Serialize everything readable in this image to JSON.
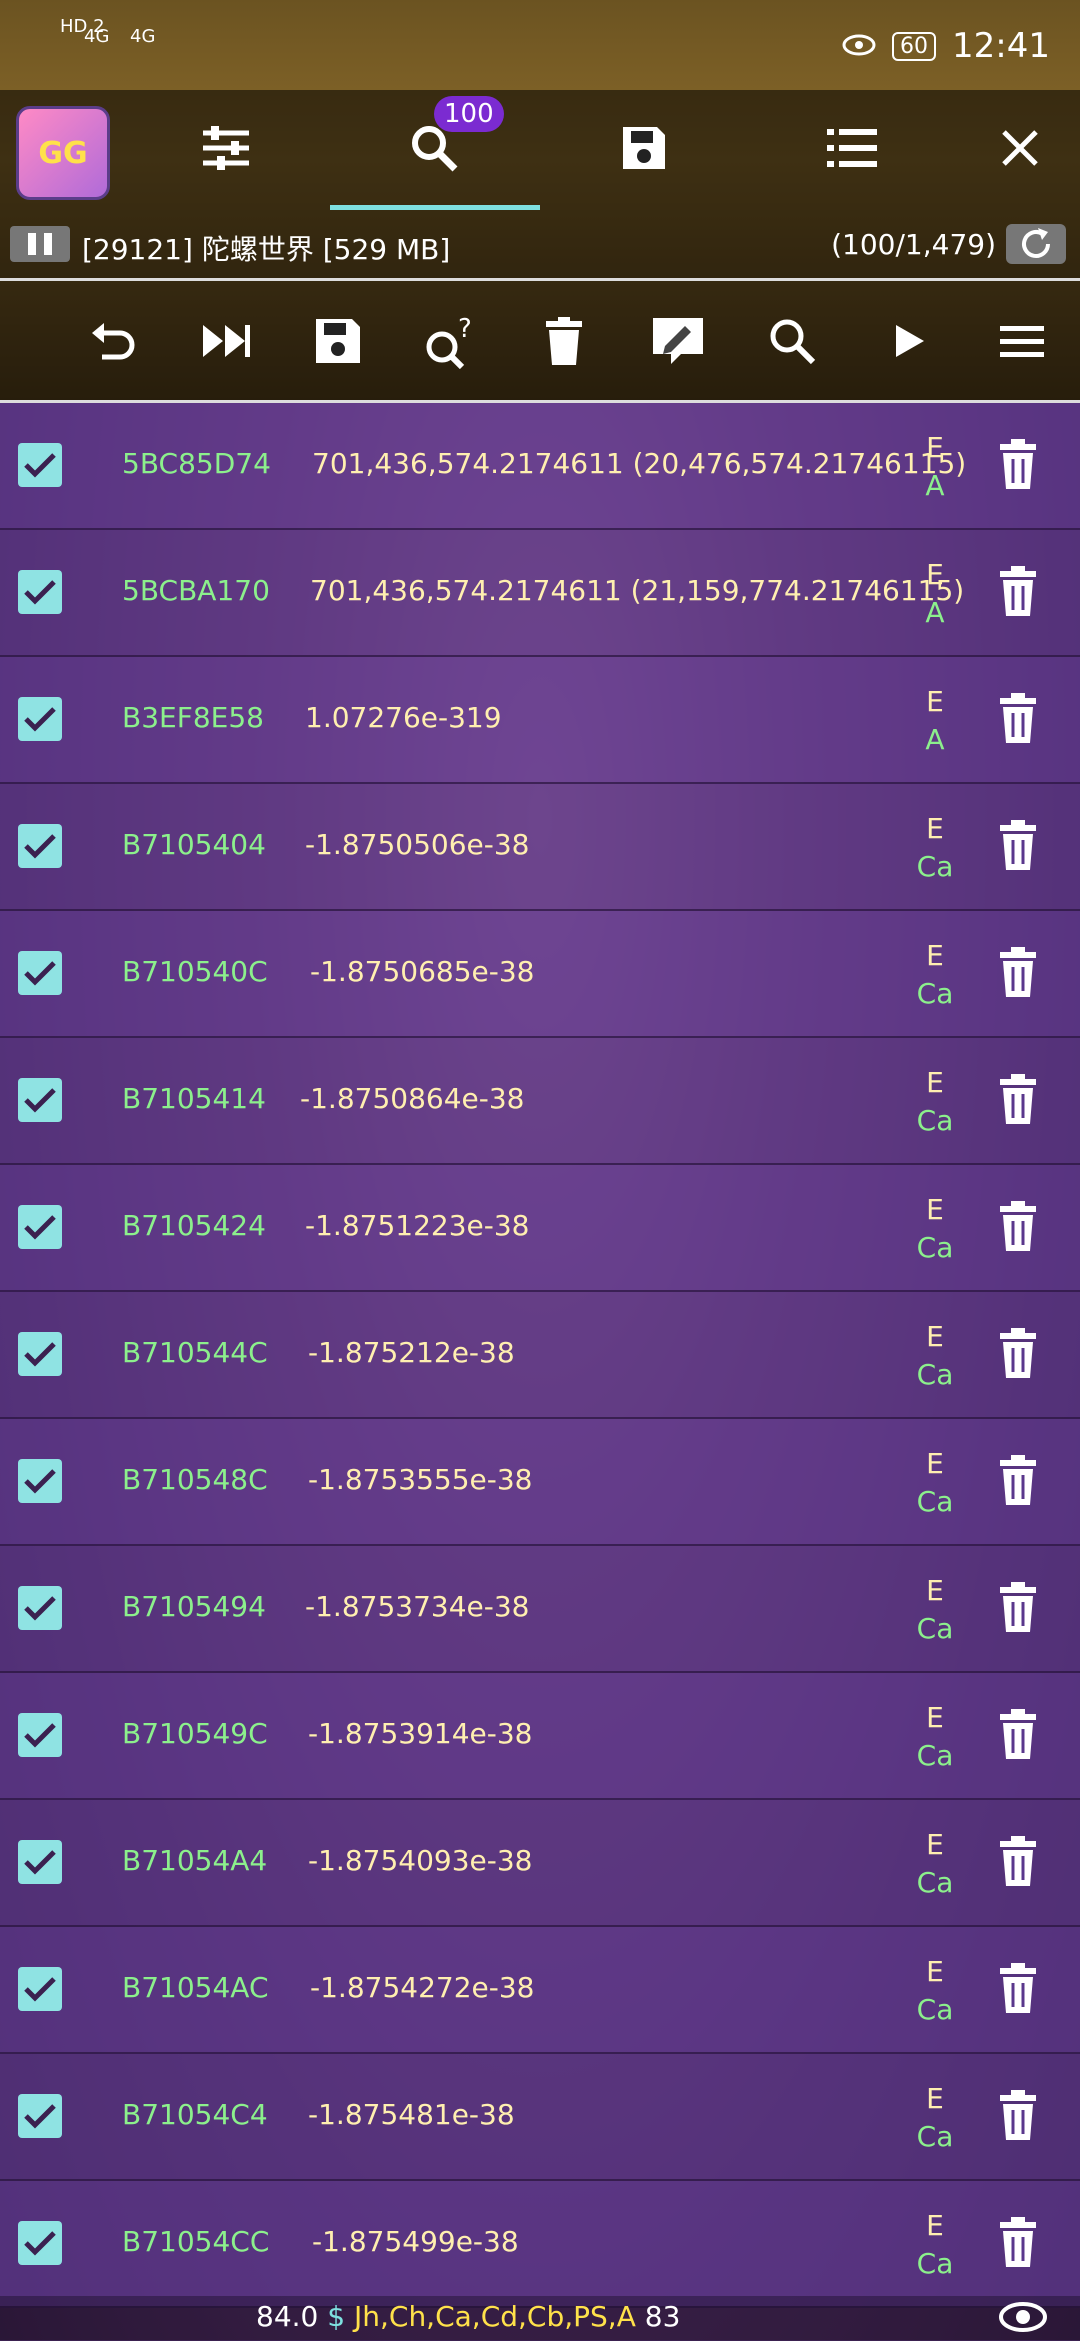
{
  "status_bar": {
    "signal_left": "HD 2",
    "network_a": "4G",
    "network_b": "4G",
    "battery": "60",
    "time": "12:41"
  },
  "header": {
    "badge_count": "100",
    "process": "[29121] 陀螺世界 [529 MB]",
    "count": "(100/1,479)"
  },
  "results": [
    {
      "addr": "5BC85D74",
      "value": "701,436,574.2174611 (20,476,574.21746115)",
      "flag1": "E",
      "flag2": "A"
    },
    {
      "addr": "5BCBA170",
      "value": "701,436,574.2174611 (21,159,774.21746115)",
      "flag1": "E",
      "flag2": "A"
    },
    {
      "addr": "B3EF8E58",
      "value": "1.07276e-319",
      "flag1": "E",
      "flag2": "A"
    },
    {
      "addr": "B7105404",
      "value": "-1.8750506e-38",
      "flag1": "E",
      "flag2": "Ca"
    },
    {
      "addr": "B710540C",
      "value": "-1.8750685e-38",
      "flag1": "E",
      "flag2": "Ca"
    },
    {
      "addr": "B7105414",
      "value": "-1.8750864e-38",
      "flag1": "E",
      "flag2": "Ca"
    },
    {
      "addr": "B7105424",
      "value": "-1.8751223e-38",
      "flag1": "E",
      "flag2": "Ca"
    },
    {
      "addr": "B710544C",
      "value": "-1.875212e-38",
      "flag1": "E",
      "flag2": "Ca"
    },
    {
      "addr": "B710548C",
      "value": "-1.8753555e-38",
      "flag1": "E",
      "flag2": "Ca"
    },
    {
      "addr": "B7105494",
      "value": "-1.8753734e-38",
      "flag1": "E",
      "flag2": "Ca"
    },
    {
      "addr": "B710549C",
      "value": "-1.8753914e-38",
      "flag1": "E",
      "flag2": "Ca"
    },
    {
      "addr": "B71054A4",
      "value": "-1.8754093e-38",
      "flag1": "E",
      "flag2": "Ca"
    },
    {
      "addr": "B71054AC",
      "value": "-1.8754272e-38",
      "flag1": "E",
      "flag2": "Ca"
    },
    {
      "addr": "B71054C4",
      "value": "-1.875481e-38",
      "flag1": "E",
      "flag2": "Ca"
    },
    {
      "addr": "B71054CC",
      "value": "-1.875499e-38",
      "flag1": "E",
      "flag2": "Ca"
    }
  ],
  "bottom": {
    "speed": "84.0",
    "dollar": "$",
    "kinds": "Jh,Ch,Ca,Cd,Cb,PS,A",
    "count": "83"
  }
}
